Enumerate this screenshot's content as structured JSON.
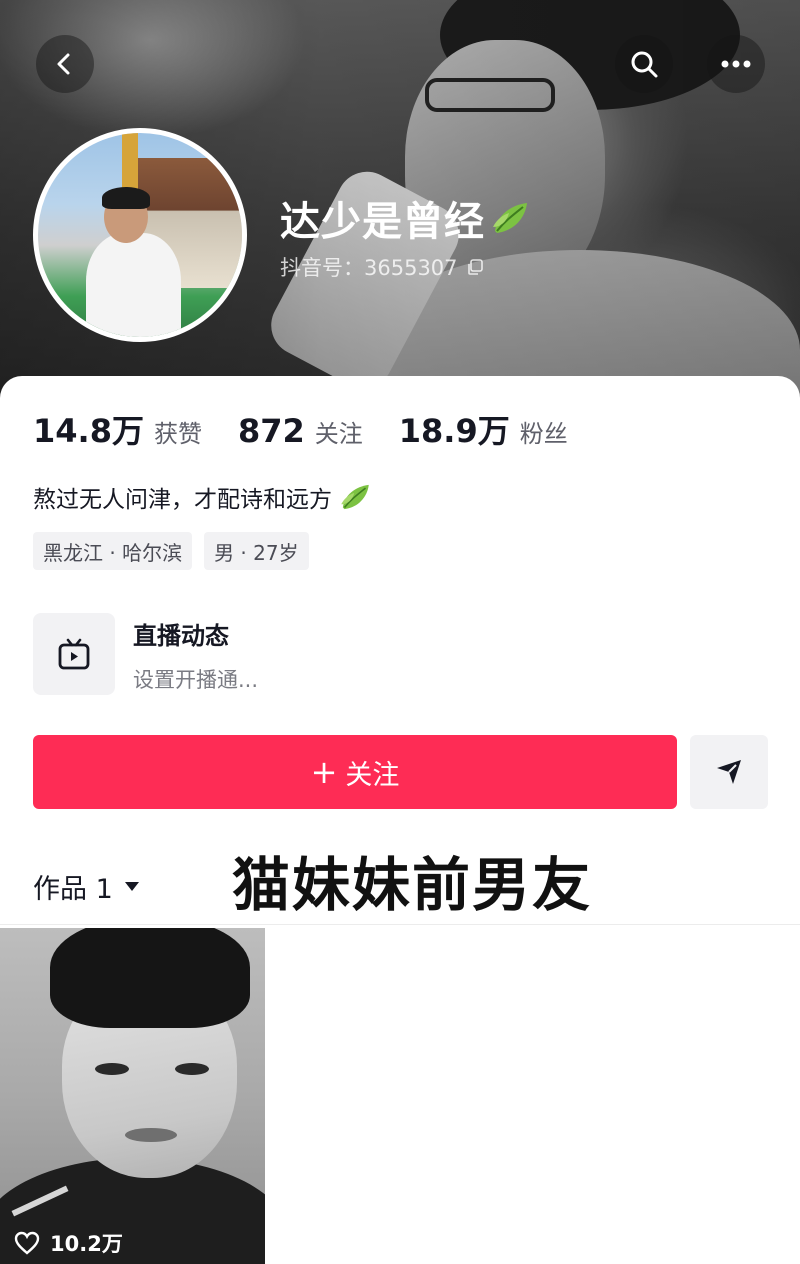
{
  "profile": {
    "nickname": "达少是曾经",
    "douyin_id": "抖音号：3655307",
    "bio": "熬过无人问津，才配诗和远方",
    "tags": [
      "黑龙江 · 哈尔滨",
      "男 · 27岁"
    ]
  },
  "stats": [
    {
      "value": "14.8万",
      "label": "获赞"
    },
    {
      "value": "872",
      "label": "关注"
    },
    {
      "value": "18.9万",
      "label": "粉丝"
    }
  ],
  "live": {
    "title": "直播动态",
    "subtitle": "设置开播通..."
  },
  "actions": {
    "follow_plus": "+",
    "follow_label": "关注"
  },
  "works": {
    "tab_label": "作品 1",
    "overlay_caption": "猫妹妹前男友",
    "videos": [
      {
        "likes": "10.2万"
      }
    ]
  },
  "colors": {
    "accent": "#fe2c55",
    "text_primary": "#161823",
    "text_secondary": "#5f606a",
    "chip_bg": "#f2f2f4"
  },
  "icons": {
    "back": "chevron-left-icon",
    "search": "search-icon",
    "more": "more-icon",
    "leaf": "leaf-icon",
    "copy": "copy-icon",
    "tv": "tv-icon",
    "send": "send-icon",
    "caret": "caret-down-icon",
    "heart": "heart-icon"
  }
}
